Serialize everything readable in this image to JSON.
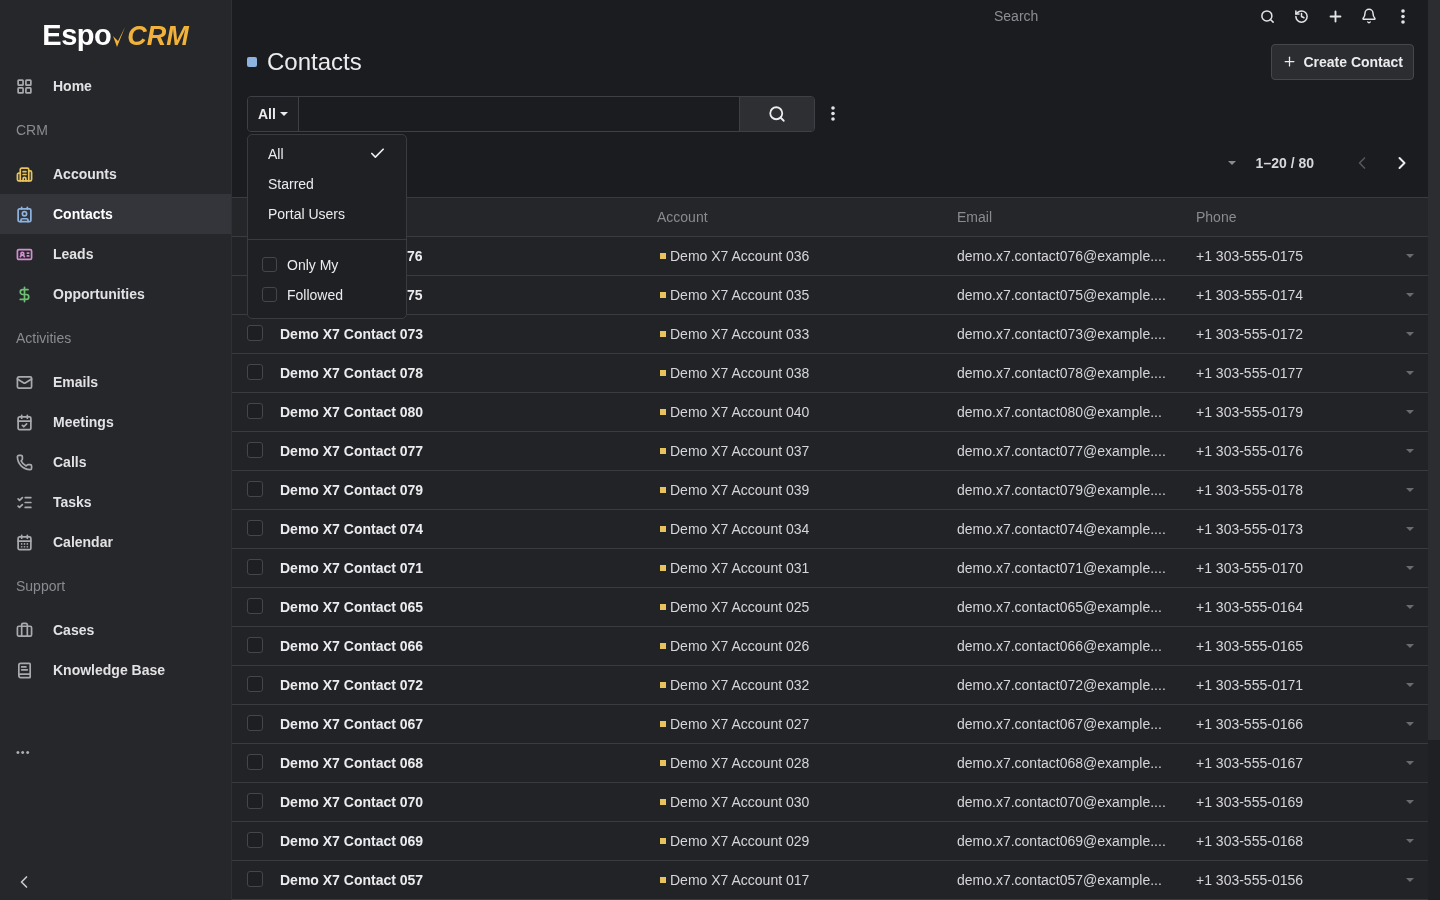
{
  "logo": {
    "text_1": "Espo",
    "text_2": "CRM"
  },
  "sidebar": {
    "sections": [
      {
        "items": [
          {
            "label": "Home",
            "selected": false
          }
        ]
      },
      {
        "title": "CRM",
        "items": [
          {
            "label": "Accounts",
            "selected": false,
            "color": "#e8c25a"
          },
          {
            "label": "Contacts",
            "selected": true,
            "color": "#8db4e0"
          },
          {
            "label": "Leads",
            "selected": false,
            "color": "#d18fcf"
          },
          {
            "label": "Opportunities",
            "selected": false,
            "color": "#6fbf73"
          }
        ]
      },
      {
        "title": "Activities",
        "items": [
          {
            "label": "Emails",
            "selected": false
          },
          {
            "label": "Meetings",
            "selected": false
          },
          {
            "label": "Calls",
            "selected": false
          },
          {
            "label": "Tasks",
            "selected": false
          },
          {
            "label": "Calendar",
            "selected": false
          }
        ]
      },
      {
        "title": "Support",
        "items": [
          {
            "label": "Cases",
            "selected": false
          },
          {
            "label": "Knowledge Base",
            "selected": false
          }
        ]
      }
    ],
    "more": "•••"
  },
  "topbar": {
    "search": {
      "placeholder": "Search"
    }
  },
  "header": {
    "title": "Contacts",
    "create_button": "Create Contact"
  },
  "filter": {
    "preset": "All",
    "menu": {
      "presets": [
        {
          "label": "All",
          "selected": true
        },
        {
          "label": "Starred",
          "selected": false
        },
        {
          "label": "Portal Users",
          "selected": false
        }
      ],
      "toggles": [
        {
          "label": "Only My",
          "checked": false
        },
        {
          "label": "Followed",
          "checked": false
        }
      ]
    }
  },
  "pagination": {
    "range": "1–20 / 80"
  },
  "table": {
    "columns": [
      "Account",
      "Email",
      "Phone"
    ],
    "rows": [
      {
        "name": "76",
        "name_covered": true,
        "account": "Demo X7 Account 036",
        "email": "demo.x7.contact076@example....",
        "phone": "+1 303-555-0175"
      },
      {
        "name": "75",
        "name_covered": true,
        "account": "Demo X7 Account 035",
        "email": "demo.x7.contact075@example....",
        "phone": "+1 303-555-0174"
      },
      {
        "name": "Demo X7 Contact 073",
        "name_covered": false,
        "account": "Demo X7 Account 033",
        "email": "demo.x7.contact073@example....",
        "phone": "+1 303-555-0172",
        "checked": false
      },
      {
        "name": "Demo X7 Contact 078",
        "name_covered": false,
        "account": "Demo X7 Account 038",
        "email": "demo.x7.contact078@example....",
        "phone": "+1 303-555-0177",
        "checked": false
      },
      {
        "name": "Demo X7 Contact 080",
        "name_covered": false,
        "account": "Demo X7 Account 040",
        "email": "demo.x7.contact080@example...",
        "phone": "+1 303-555-0179",
        "checked": false
      },
      {
        "name": "Demo X7 Contact 077",
        "name_covered": false,
        "account": "Demo X7 Account 037",
        "email": "demo.x7.contact077@example....",
        "phone": "+1 303-555-0176",
        "checked": false
      },
      {
        "name": "Demo X7 Contact 079",
        "name_covered": false,
        "account": "Demo X7 Account 039",
        "email": "demo.x7.contact079@example....",
        "phone": "+1 303-555-0178",
        "checked": false
      },
      {
        "name": "Demo X7 Contact 074",
        "name_covered": false,
        "account": "Demo X7 Account 034",
        "email": "demo.x7.contact074@example....",
        "phone": "+1 303-555-0173",
        "checked": false
      },
      {
        "name": "Demo X7 Contact 071",
        "name_covered": false,
        "account": "Demo X7 Account 031",
        "email": "demo.x7.contact071@example....",
        "phone": "+1 303-555-0170",
        "checked": false
      },
      {
        "name": "Demo X7 Contact 065",
        "name_covered": false,
        "account": "Demo X7 Account 025",
        "email": "demo.x7.contact065@example...",
        "phone": "+1 303-555-0164",
        "checked": false
      },
      {
        "name": "Demo X7 Contact 066",
        "name_covered": false,
        "account": "Demo X7 Account 026",
        "email": "demo.x7.contact066@example...",
        "phone": "+1 303-555-0165",
        "checked": false
      },
      {
        "name": "Demo X7 Contact 072",
        "name_covered": false,
        "account": "Demo X7 Account 032",
        "email": "demo.x7.contact072@example....",
        "phone": "+1 303-555-0171",
        "checked": false
      },
      {
        "name": "Demo X7 Contact 067",
        "name_covered": false,
        "account": "Demo X7 Account 027",
        "email": "demo.x7.contact067@example...",
        "phone": "+1 303-555-0166",
        "checked": false
      },
      {
        "name": "Demo X7 Contact 068",
        "name_covered": false,
        "account": "Demo X7 Account 028",
        "email": "demo.x7.contact068@example...",
        "phone": "+1 303-555-0167",
        "checked": false
      },
      {
        "name": "Demo X7 Contact 070",
        "name_covered": false,
        "account": "Demo X7 Account 030",
        "email": "demo.x7.contact070@example....",
        "phone": "+1 303-555-0169",
        "checked": false
      },
      {
        "name": "Demo X7 Contact 069",
        "name_covered": false,
        "account": "Demo X7 Account 029",
        "email": "demo.x7.contact069@example....",
        "phone": "+1 303-555-0168",
        "checked": false
      },
      {
        "name": "Demo X7 Contact 057",
        "name_covered": false,
        "account": "Demo X7 Account 017",
        "email": "demo.x7.contact057@example...",
        "phone": "+1 303-555-0156",
        "checked": false
      }
    ]
  }
}
